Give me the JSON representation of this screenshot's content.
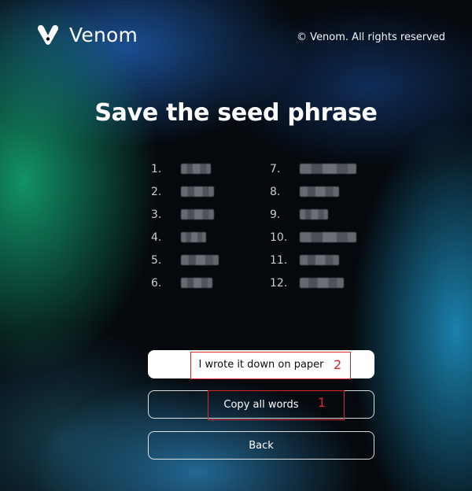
{
  "header": {
    "logo_text": "Venom",
    "copyright": "© Venom. All rights reserved"
  },
  "main": {
    "title": "Save the seed phrase",
    "seed_words": [
      {
        "number": "1."
      },
      {
        "number": "2."
      },
      {
        "number": "3."
      },
      {
        "number": "4."
      },
      {
        "number": "5."
      },
      {
        "number": "6."
      },
      {
        "number": "7."
      },
      {
        "number": "8."
      },
      {
        "number": "9."
      },
      {
        "number": "10."
      },
      {
        "number": "11."
      },
      {
        "number": "12."
      }
    ],
    "buttons": {
      "wrote_down": "I wrote it down on paper",
      "copy_all": "Copy all words",
      "back": "Back"
    }
  },
  "annotations": {
    "marker_1": "1",
    "marker_2": "2",
    "color": "#d8262b"
  },
  "colors": {
    "background": "#05080c",
    "primary_button_bg": "#ffffff"
  }
}
